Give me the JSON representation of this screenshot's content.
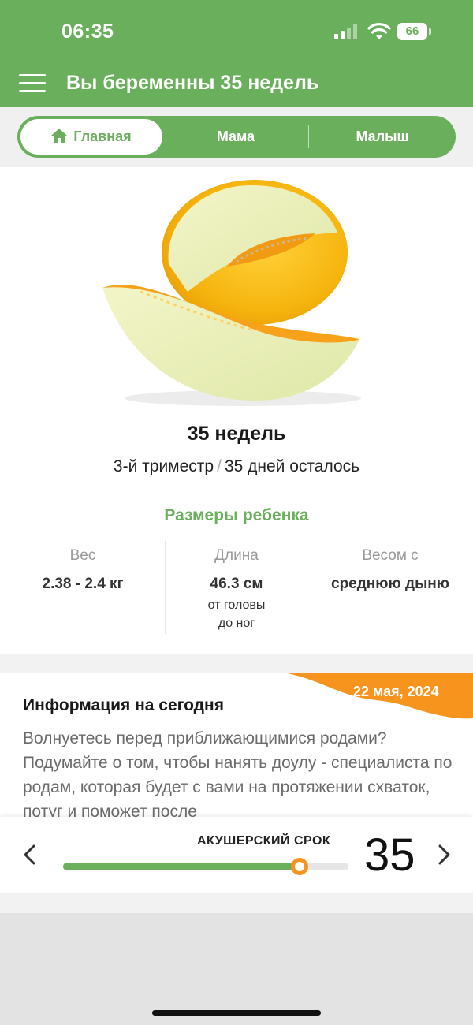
{
  "status_bar": {
    "time": "06:35",
    "battery": "66"
  },
  "header": {
    "title": "Вы беременны 35 недель"
  },
  "tabs": [
    {
      "label": "Главная",
      "active": true
    },
    {
      "label": "Мама",
      "active": false
    },
    {
      "label": "Малыш",
      "active": false
    }
  ],
  "main": {
    "fruit_icon": "melon",
    "weeks_title": "35 недель",
    "trimester": "3-й триместр",
    "separator": "/",
    "days_left": "35 дней осталось",
    "sizes_title": "Размеры ребенка",
    "sizes": [
      {
        "label": "Вес",
        "value": "2.38 - 2.4 кг",
        "note": []
      },
      {
        "label": "Длина",
        "value": "46.3 см",
        "note": [
          "от головы",
          "до ног"
        ]
      },
      {
        "label": "Весом с",
        "value": "среднюю дыню",
        "note": []
      }
    ]
  },
  "info": {
    "date": "22 мая, 2024",
    "title": "Информация на сегодня",
    "text": "Волнуетесь перед приближающимися родами? Подумайте о том, чтобы нанять доулу - специалиста по родам, которая будет с вами на протяжении схваток, потуг и поможет после"
  },
  "term_slider": {
    "label": "АКУШЕРСКИЙ СРОК",
    "week": "35",
    "progress_fraction": 0.83
  },
  "colors": {
    "brand_green": "#6aaf5b",
    "accent_orange": "#f7941d"
  }
}
